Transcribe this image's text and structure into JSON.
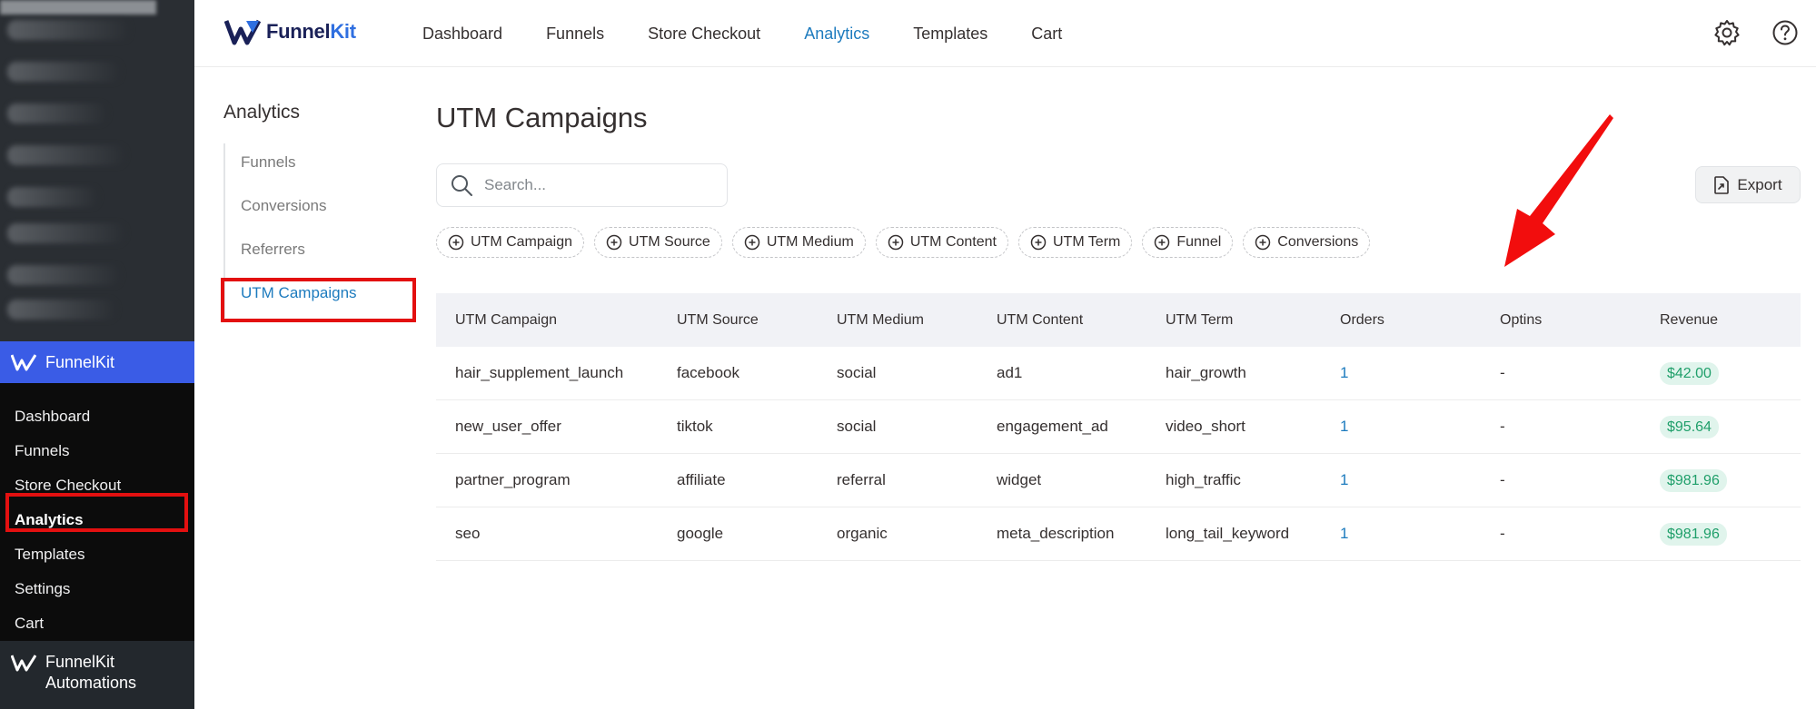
{
  "wp_sidebar": {
    "brand": "FunnelKit",
    "items": [
      {
        "label": "Dashboard"
      },
      {
        "label": "Funnels"
      },
      {
        "label": "Store Checkout"
      },
      {
        "label": "Analytics"
      },
      {
        "label": "Templates"
      },
      {
        "label": "Settings"
      },
      {
        "label": "Cart"
      }
    ],
    "active_item": "Analytics",
    "automations_line1": "FunnelKit",
    "automations_line2": "Automations"
  },
  "header": {
    "logo_main": "Funnel",
    "logo_accent": "Kit",
    "nav": [
      {
        "label": "Dashboard"
      },
      {
        "label": "Funnels"
      },
      {
        "label": "Store Checkout"
      },
      {
        "label": "Analytics"
      },
      {
        "label": "Templates"
      },
      {
        "label": "Cart"
      }
    ],
    "active_nav": "Analytics",
    "icons": [
      "gear-icon",
      "help-icon"
    ]
  },
  "analytics_nav": {
    "title": "Analytics",
    "items": [
      {
        "label": "Funnels"
      },
      {
        "label": "Conversions"
      },
      {
        "label": "Referrers"
      },
      {
        "label": "UTM Campaigns"
      }
    ],
    "active_item": "UTM Campaigns"
  },
  "main": {
    "title": "UTM Campaigns",
    "search_placeholder": "Search...",
    "export_label": "Export",
    "filters": [
      {
        "label": "UTM Campaign"
      },
      {
        "label": "UTM Source"
      },
      {
        "label": "UTM Medium"
      },
      {
        "label": "UTM Content"
      },
      {
        "label": "UTM Term"
      },
      {
        "label": "Funnel"
      },
      {
        "label": "Conversions"
      }
    ],
    "table": {
      "columns": [
        "UTM Campaign",
        "UTM Source",
        "UTM Medium",
        "UTM Content",
        "UTM Term",
        "Orders",
        "Optins",
        "Revenue"
      ],
      "rows": [
        {
          "campaign": "hair_supplement_launch",
          "source": "facebook",
          "medium": "social",
          "content": "ad1",
          "term": "hair_growth",
          "orders": "1",
          "optins": "-",
          "revenue": "$42.00"
        },
        {
          "campaign": "new_user_offer",
          "source": "tiktok",
          "medium": "social",
          "content": "engagement_ad",
          "term": "video_short",
          "orders": "1",
          "optins": "-",
          "revenue": "$95.64"
        },
        {
          "campaign": "partner_program",
          "source": "affiliate",
          "medium": "referral",
          "content": "widget",
          "term": "high_traffic",
          "orders": "1",
          "optins": "-",
          "revenue": "$981.96"
        },
        {
          "campaign": "seo",
          "source": "google",
          "medium": "organic",
          "content": "meta_description",
          "term": "long_tail_keyword",
          "orders": "1",
          "optins": "-",
          "revenue": "$981.96"
        }
      ]
    }
  },
  "colors": {
    "accent_blue": "#1d7bbe",
    "brand_blue": "#3a5ce6",
    "highlight_red": "#e31010",
    "revenue_green": "#1f9f6a"
  }
}
